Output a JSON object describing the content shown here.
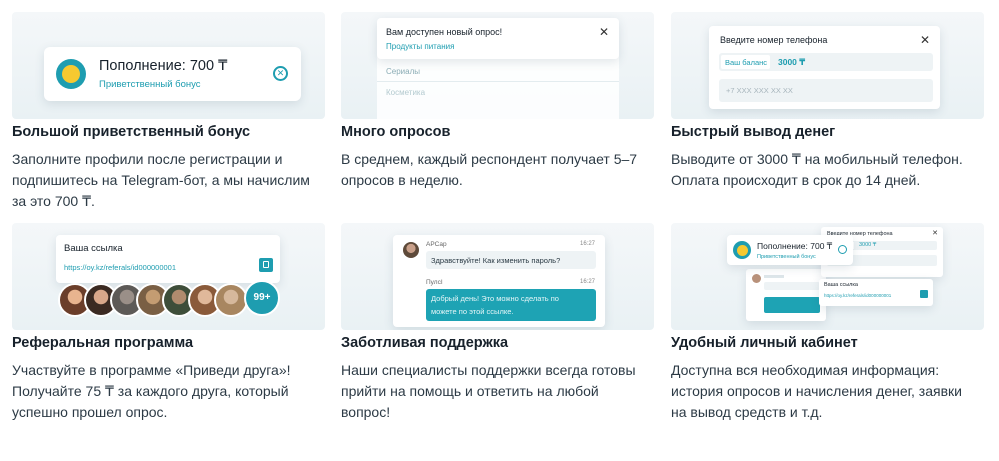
{
  "cards": [
    {
      "title": "Большой приветственный бонус",
      "desc": "Заполните профили после регистрации и подпишитесь на Telegram-бот, а мы начислим за это 700 ₸.",
      "illus": {
        "heading": "Пополнение: 700 ₸",
        "sub": "Приветственный бонус"
      }
    },
    {
      "title": "Много опросов",
      "desc": "В среднем, каждый респондент получает 5–7 опросов в неделю.",
      "illus": {
        "heading": "Вам доступен новый опрос!",
        "link": "Продукты питания",
        "items": [
          "Сериалы",
          "Косметика"
        ]
      }
    },
    {
      "title": "Быстрый вывод денег",
      "desc": "Выводите от 3000 ₸ на мобильный телефон. Оплата происходит в срок до 14 дней.",
      "illus": {
        "heading": "Введите номер телефона",
        "balance_label": "Ваш баланс",
        "balance_value": "3000 ₸",
        "placeholder": "+7 XXX XXX XX XX"
      }
    },
    {
      "title": "Реферальная программа",
      "desc": "Участвуйте в программе «Приведи друга»! Получайте 75 ₸ за каждого друга, который успешно прошел опрос.",
      "illus": {
        "heading": "Ваша ссылка",
        "link": "https://oy.kz/referals/id000000001",
        "more": "99+"
      }
    },
    {
      "title": "Заботливая поддержка",
      "desc": "Наши специалисты поддержки всегда готовы прийти на помощь и ответить на любой вопрос!",
      "illus": {
        "user1": "АРСар",
        "time1": "16:27",
        "msg1": "Здравствуйте! Как изменить пароль?",
        "user2": "ПулсI",
        "time2": "16:27",
        "msg2": "Добрый день! Это можно сделать по",
        "msg2b": "можете по этой ссылке."
      }
    },
    {
      "title": "Удобный личный кабинет",
      "desc": "Доступна вся необходимая информация: история опросов и начисления денег, заявки на вывод средств и т.д.",
      "illus": {
        "heading": "Пополнение: 700 ₸",
        "sub": "Приветственный бонус",
        "phone_heading": "Введите номер телефона",
        "balance_value": "3000 ₸",
        "link_heading": "Ваша ссылка",
        "link": "https://oy.kz/referals/id000000001"
      }
    }
  ],
  "colors": {
    "accent": "#1e9db0",
    "coin": "#f6c930",
    "bg": "#eef4f6"
  }
}
